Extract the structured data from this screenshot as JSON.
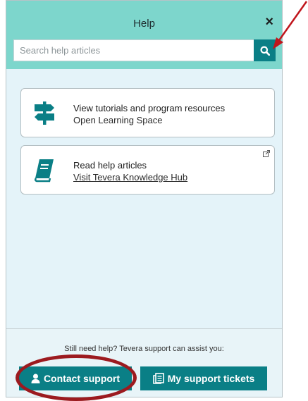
{
  "panel": {
    "title": "Help",
    "close_label": "×"
  },
  "search": {
    "placeholder": "Search help articles",
    "button_icon": "search-icon"
  },
  "cards": [
    {
      "icon": "signpost-icon",
      "title": "View tutorials and program resources",
      "subtitle": "Open Learning Space"
    },
    {
      "icon": "book-icon",
      "title": "Read help articles",
      "subtitle": "Visit Tevera Knowledge Hub",
      "external_icon": "external-link-icon"
    }
  ],
  "footer": {
    "text": "Still need help? Tevera support can assist you:",
    "contact_label": "Contact support",
    "tickets_label": "My support tickets"
  },
  "colors": {
    "header": "#7dd6cc",
    "accent": "#0a7f86",
    "panel_bg": "#e4f3f9",
    "annotation": "#9c1a1f"
  }
}
